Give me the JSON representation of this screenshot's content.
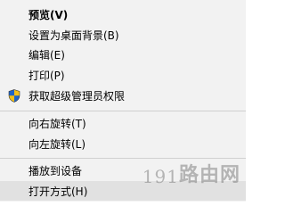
{
  "context_menu": {
    "items": [
      {
        "label": "预览(V)"
      },
      {
        "label": "设置为桌面背景(B)"
      },
      {
        "label": "编辑(E)"
      },
      {
        "label": "打印(P)"
      },
      {
        "label": "获取超级管理员权限",
        "icon": "uac-shield-icon"
      },
      {
        "label": "向右旋转(T)"
      },
      {
        "label": "向左旋转(L)"
      },
      {
        "label": "播放到设备"
      },
      {
        "label": "打开方式(H)"
      }
    ]
  },
  "watermark": {
    "digits": "191",
    "text": "路由网"
  },
  "colors": {
    "menu_bg": "#f2f2f2",
    "hover_bg": "#e1e1e1",
    "separator": "#d0d0d0",
    "shield_blue": "#1e64c8",
    "shield_yellow": "#f2c018"
  }
}
